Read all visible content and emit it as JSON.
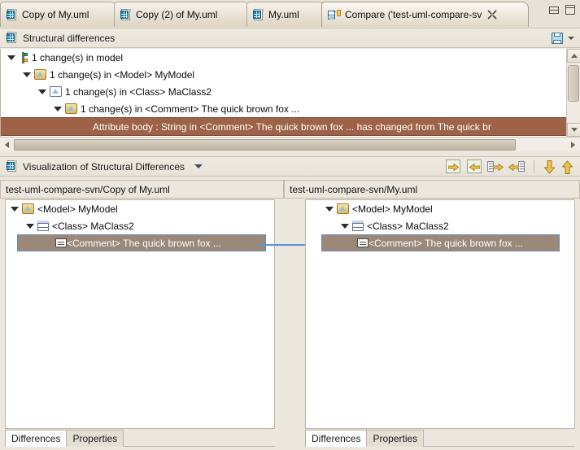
{
  "window": {
    "minimize_label": "Minimize",
    "maximize_label": "Maximize"
  },
  "editor_tabs": [
    {
      "label": "Copy of My.uml",
      "icon": "uml-document-icon",
      "active": false,
      "closable": false
    },
    {
      "label": "Copy (2) of My.uml",
      "icon": "uml-document-icon",
      "active": false,
      "closable": false
    },
    {
      "label": "My.uml",
      "icon": "uml-document-icon",
      "active": false,
      "closable": false
    },
    {
      "label": "Compare ('test-uml-compare-sv",
      "icon": "compare-icon",
      "active": true,
      "closable": true
    }
  ],
  "structural": {
    "title": "Structural differences",
    "icon": "uml-document-icon",
    "save_icon": "save-icon",
    "menu_icon": "view-menu-chevron-icon",
    "tree": [
      {
        "indent": 0,
        "label": "1 change(s) in model",
        "icon": "change-icon",
        "expanded": true
      },
      {
        "indent": 1,
        "label": "1 change(s) in <Model> MyModel",
        "icon": "model-folder-icon",
        "expanded": true
      },
      {
        "indent": 2,
        "label": "1 change(s) in <Class> MaClass2",
        "icon": "class-icon",
        "expanded": true
      },
      {
        "indent": 3,
        "label": "1 change(s) in <Comment> The quick brown fox ...",
        "icon": "model-folder-icon",
        "expanded": true
      }
    ],
    "selected_row": "Attribute body : String in <Comment> The quick brown fox ... has changed from The quick br"
  },
  "visualization": {
    "title": "Visualization of Structural Differences",
    "icon": "uml-document-icon",
    "menu_caret": "view-menu-caret-icon",
    "toolbar": [
      {
        "name": "copy-all-left-to-right-button",
        "icon": "copy-all-right-icon"
      },
      {
        "name": "copy-all-right-to-left-button",
        "icon": "copy-all-left-icon"
      },
      {
        "name": "copy-current-left-to-right-button",
        "icon": "copy-right-icon"
      },
      {
        "name": "copy-current-right-to-left-button",
        "icon": "copy-left-icon"
      },
      {
        "name": "next-difference-button",
        "icon": "down-arrow-icon"
      },
      {
        "name": "previous-difference-button",
        "icon": "up-arrow-icon"
      }
    ],
    "left_panel": {
      "path": "test-uml-compare-svn/Copy of My.uml",
      "tree": [
        {
          "indent": 0,
          "label": "<Model> MyModel",
          "icon": "model-folder-icon",
          "expanded": true,
          "highlight": false
        },
        {
          "indent": 1,
          "label": "<Class> MaClass2",
          "icon": "class-icon",
          "expanded": true,
          "highlight": false
        },
        {
          "indent": 2,
          "label": "<Comment> The quick brown fox ...",
          "icon": "comment-icon",
          "expanded": false,
          "highlight": true
        }
      ],
      "tabs": [
        {
          "label": "Differences",
          "active": true
        },
        {
          "label": "Properties",
          "active": false
        }
      ]
    },
    "right_panel": {
      "path": "test-uml-compare-svn/My.uml",
      "tree": [
        {
          "indent": 0,
          "label": "<Model> MyModel",
          "icon": "model-folder-icon",
          "expanded": true,
          "highlight": false
        },
        {
          "indent": 1,
          "label": "<Class> MaClass2",
          "icon": "class-icon",
          "expanded": true,
          "highlight": false
        },
        {
          "indent": 2,
          "label": "<Comment> The quick brown fox ...",
          "icon": "comment-icon",
          "expanded": false,
          "highlight": true
        }
      ],
      "tabs": [
        {
          "label": "Differences",
          "active": true
        },
        {
          "label": "Properties",
          "active": false
        }
      ]
    }
  },
  "colors": {
    "selection_brown": "#9d6247",
    "highlight_brown": "#9c8878",
    "connector_blue": "#5b93d6",
    "chrome": "#ece7de"
  }
}
